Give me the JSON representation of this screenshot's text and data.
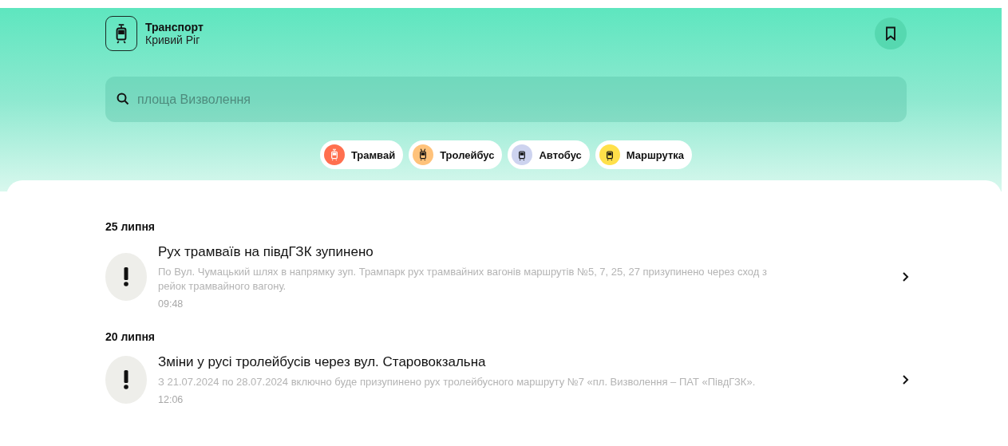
{
  "header": {
    "title": "Транспорт",
    "city": "Кривий Ріг"
  },
  "search": {
    "placeholder": "площа Визволення"
  },
  "filters": [
    {
      "label": "Трамвай",
      "kind": "tram",
      "color": "#ff6f4f"
    },
    {
      "label": "Тролейбус",
      "kind": "trolleybus",
      "color": "#ffc27a"
    },
    {
      "label": "Автобус",
      "kind": "bus",
      "color": "#cdd3ef"
    },
    {
      "label": "Маршрутка",
      "kind": "minibus",
      "color": "#ffe04a"
    }
  ],
  "news": [
    {
      "date": "25 липня",
      "title": "Рух трамваїв на півдГЗК зупинено",
      "text": "По Вул. Чумацький шлях в напрямку зуп. Трампарк рух трамвайних вагонів маршрутів №5, 7, 25, 27 призупинено через сход з рейок трамвайного вагону.",
      "time": "09:48"
    },
    {
      "date": "20 липня",
      "title": "Зміни у русі тролейбусів через вул. Старовокзальна",
      "text": "З 21.07.2024 по 28.07.2024 включно буде призупинено рух тролейбусного маршруту  №7 «пл. Визволення – ПАТ «ПівдГЗК».",
      "time": "12:06"
    }
  ]
}
